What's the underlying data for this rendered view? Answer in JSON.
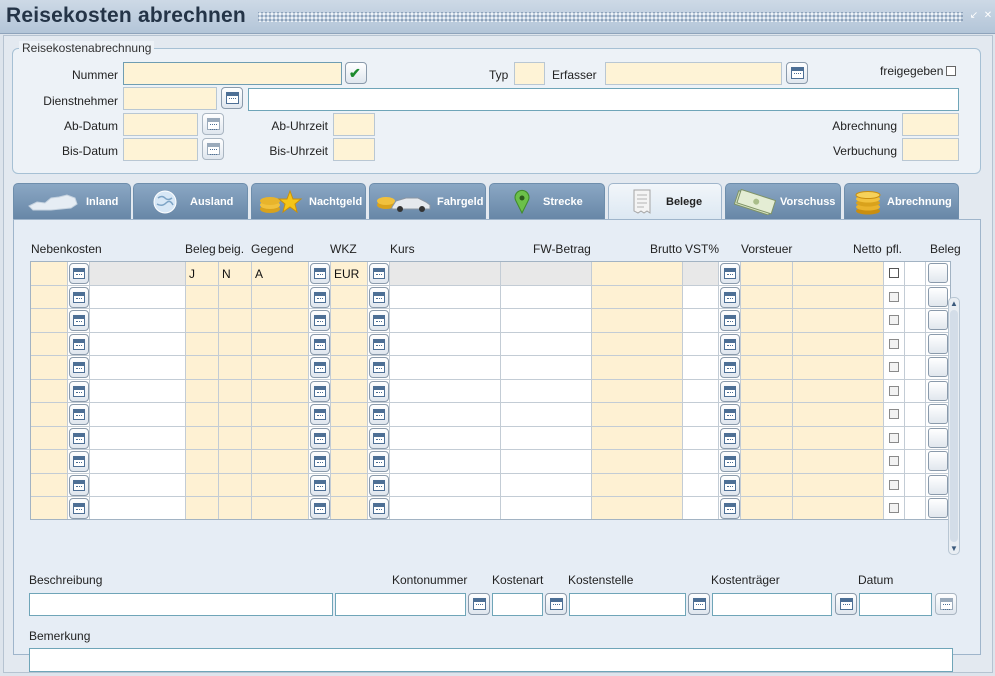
{
  "window": {
    "title": "Reisekosten abrechnen"
  },
  "header": {
    "group_title": "Reisekostenabrechnung",
    "nummer_label": "Nummer",
    "typ_label": "Typ",
    "erfasser_label": "Erfasser",
    "freigegeben_label": "freigegeben",
    "dienstnehmer_label": "Dienstnehmer",
    "ab_datum_label": "Ab-Datum",
    "ab_uhrzeit_label": "Ab-Uhrzeit",
    "bis_datum_label": "Bis-Datum",
    "bis_uhrzeit_label": "Bis-Uhrzeit",
    "abrechnung_label": "Abrechnung",
    "verbuchung_label": "Verbuchung"
  },
  "tabs": [
    {
      "label": "Inland",
      "icon": "austria-map-icon"
    },
    {
      "label": "Ausland",
      "icon": "globe-icon"
    },
    {
      "label": "Nachtgeld",
      "icon": "coins-stars-icon"
    },
    {
      "label": "Fahrgeld",
      "icon": "car-coins-icon"
    },
    {
      "label": "Strecke",
      "icon": "map-pin-icon"
    },
    {
      "label": "Belege",
      "icon": "receipt-icon"
    },
    {
      "label": "Vorschuss",
      "icon": "banknotes-icon"
    },
    {
      "label": "Abrechnung",
      "icon": "coin-stack-icon"
    }
  ],
  "active_tab": "Belege",
  "grid": {
    "columns": {
      "nebenkosten": "Nebenkosten",
      "beleg": "Beleg",
      "beig": "beig.",
      "gegend": "Gegend",
      "wkz": "WKZ",
      "kurs": "Kurs",
      "fw_betrag": "FW-Betrag",
      "brutto": "Brutto",
      "vst": "VST%",
      "vorsteuer": "Vorsteuer",
      "netto": "Netto",
      "pfl": "pfl.",
      "beleg2": "Beleg"
    },
    "first_row": {
      "beleg": "J",
      "beig": "N",
      "gegend": "A",
      "wkz": "EUR"
    }
  },
  "footer": {
    "beschreibung_label": "Beschreibung",
    "kontonummer_label": "Kontonummer",
    "kostenart_label": "Kostenart",
    "kostenstelle_label": "Kostenstelle",
    "kostentraeger_label": "Kostenträger",
    "datum_label": "Datum",
    "bemerkung_label": "Bemerkung"
  }
}
